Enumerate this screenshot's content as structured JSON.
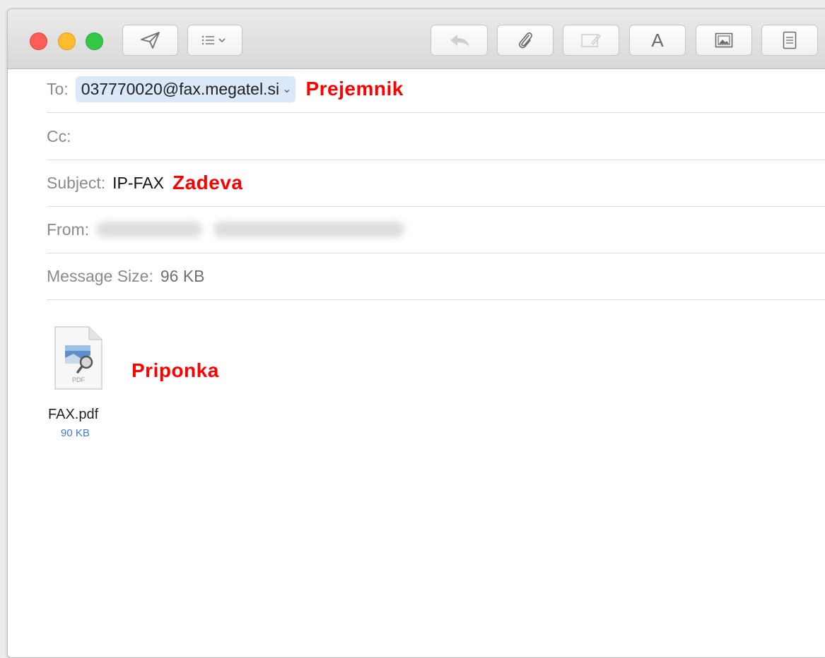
{
  "toolbar": {
    "buttons": [
      {
        "name": "send-button",
        "icon": "paper-plane-icon"
      },
      {
        "name": "header-fields-button",
        "icon": "list-chevron-icon"
      },
      {
        "name": "reply-button",
        "icon": "reply-arrow-icon"
      },
      {
        "name": "attach-button",
        "icon": "paperclip-icon"
      },
      {
        "name": "markup-button",
        "icon": "markup-icon"
      },
      {
        "name": "format-button",
        "icon": "font-a-icon",
        "label": "A"
      },
      {
        "name": "photo-browser-button",
        "icon": "photo-icon"
      },
      {
        "name": "stationery-button",
        "icon": "template-icon"
      }
    ]
  },
  "fields": {
    "to_label": "To:",
    "to_value": "037770020@fax.megatel.si",
    "to_note": "Prejemnik",
    "cc_label": "Cc:",
    "subject_label": "Subject:",
    "subject_value": "IP-FAX",
    "subject_note": "Zadeva",
    "from_label": "From:",
    "message_size_label": "Message Size:",
    "message_size_value": "96 KB"
  },
  "attachment": {
    "type_label": "PDF",
    "filename": "FAX.pdf",
    "size": "90 KB",
    "note": "Priponka"
  },
  "colors": {
    "annotation_red": "#ff0000",
    "token_blue": "#dbe8f9",
    "size_blue": "#3b7ad9"
  }
}
